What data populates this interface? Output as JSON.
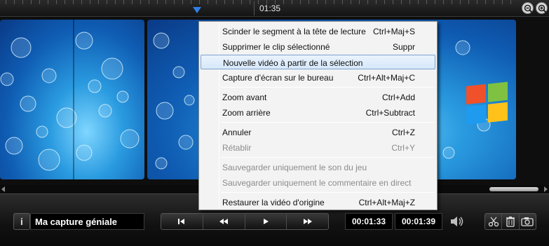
{
  "timeline": {
    "current_time": "01:35"
  },
  "context_menu": {
    "items": [
      {
        "label": "Scinder le segment à la tête de lecture",
        "shortcut": "Ctrl+Maj+S",
        "enabled": true
      },
      {
        "label": "Supprimer le clip sélectionné",
        "shortcut": "Suppr",
        "enabled": true
      },
      {
        "label": "Nouvelle vidéo à partir de la sélection",
        "shortcut": "",
        "enabled": true,
        "highlighted": true
      },
      {
        "label": "Capture d'écran sur le bureau",
        "shortcut": "Ctrl+Alt+Maj+C",
        "enabled": true
      },
      {
        "label": "Zoom avant",
        "shortcut": "Ctrl+Add",
        "enabled": true
      },
      {
        "label": "Zoom arrière",
        "shortcut": "Ctrl+Subtract",
        "enabled": true
      },
      {
        "label": "Annuler",
        "shortcut": "Ctrl+Z",
        "enabled": true
      },
      {
        "label": "Rétablir",
        "shortcut": "Ctrl+Y",
        "enabled": false
      },
      {
        "label": "Sauvegarder uniquement le son du jeu",
        "shortcut": "",
        "enabled": false
      },
      {
        "label": "Sauvegarder uniquement le commentaire en direct",
        "shortcut": "",
        "enabled": false
      },
      {
        "label": "Restaurer la vidéo d'origine",
        "shortcut": "Ctrl+Alt+Maj+Z",
        "enabled": true
      }
    ]
  },
  "controls": {
    "info_glyph": "i",
    "video_title": "Ma capture géniale",
    "start_time": "00:01:33",
    "end_time": "00:01:39"
  },
  "icons": {
    "zoom_out": "zoom-out-icon",
    "zoom_in": "zoom-in-icon",
    "skip_start": "skip-to-start-icon",
    "rewind": "rewind-icon",
    "play": "play-icon",
    "fast_forward": "fast-forward-icon",
    "volume": "speaker-icon",
    "scissors": "scissors-icon",
    "trash": "trash-icon",
    "camera": "camera-icon"
  },
  "colors": {
    "playhead": "#2f7fe6",
    "menu_highlight": "#d7e8fa",
    "menu_disabled_text": "#8c8c8c"
  }
}
